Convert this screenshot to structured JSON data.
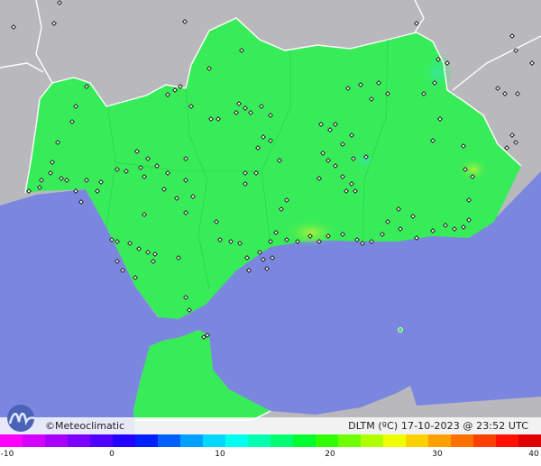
{
  "credit": "©Meteoclimatic",
  "caption": {
    "variable": "DLTM (ºC)",
    "datetime": "17-10-2023 @ 23:52 UTC"
  },
  "legend": {
    "ticks": [
      "-10",
      "0",
      "10",
      "20",
      "30",
      "40"
    ],
    "colors": [
      "#ff00ff",
      "#d400ff",
      "#a800ff",
      "#7c00ff",
      "#5000ff",
      "#2400ff",
      "#0020ff",
      "#0060ff",
      "#00a0ff",
      "#00d8ff",
      "#00fff0",
      "#00ffb0",
      "#00ff70",
      "#00ff30",
      "#30ff00",
      "#70ff00",
      "#b0ff00",
      "#f0ff00",
      "#ffd000",
      "#ffa000",
      "#ff7000",
      "#ff4000",
      "#ff1000",
      "#e00000"
    ]
  },
  "colors": {
    "sea": "#7b86df",
    "land_outside": "#b9b9bd",
    "region_fill": "#37ec58",
    "border": "#ffffff"
  }
}
